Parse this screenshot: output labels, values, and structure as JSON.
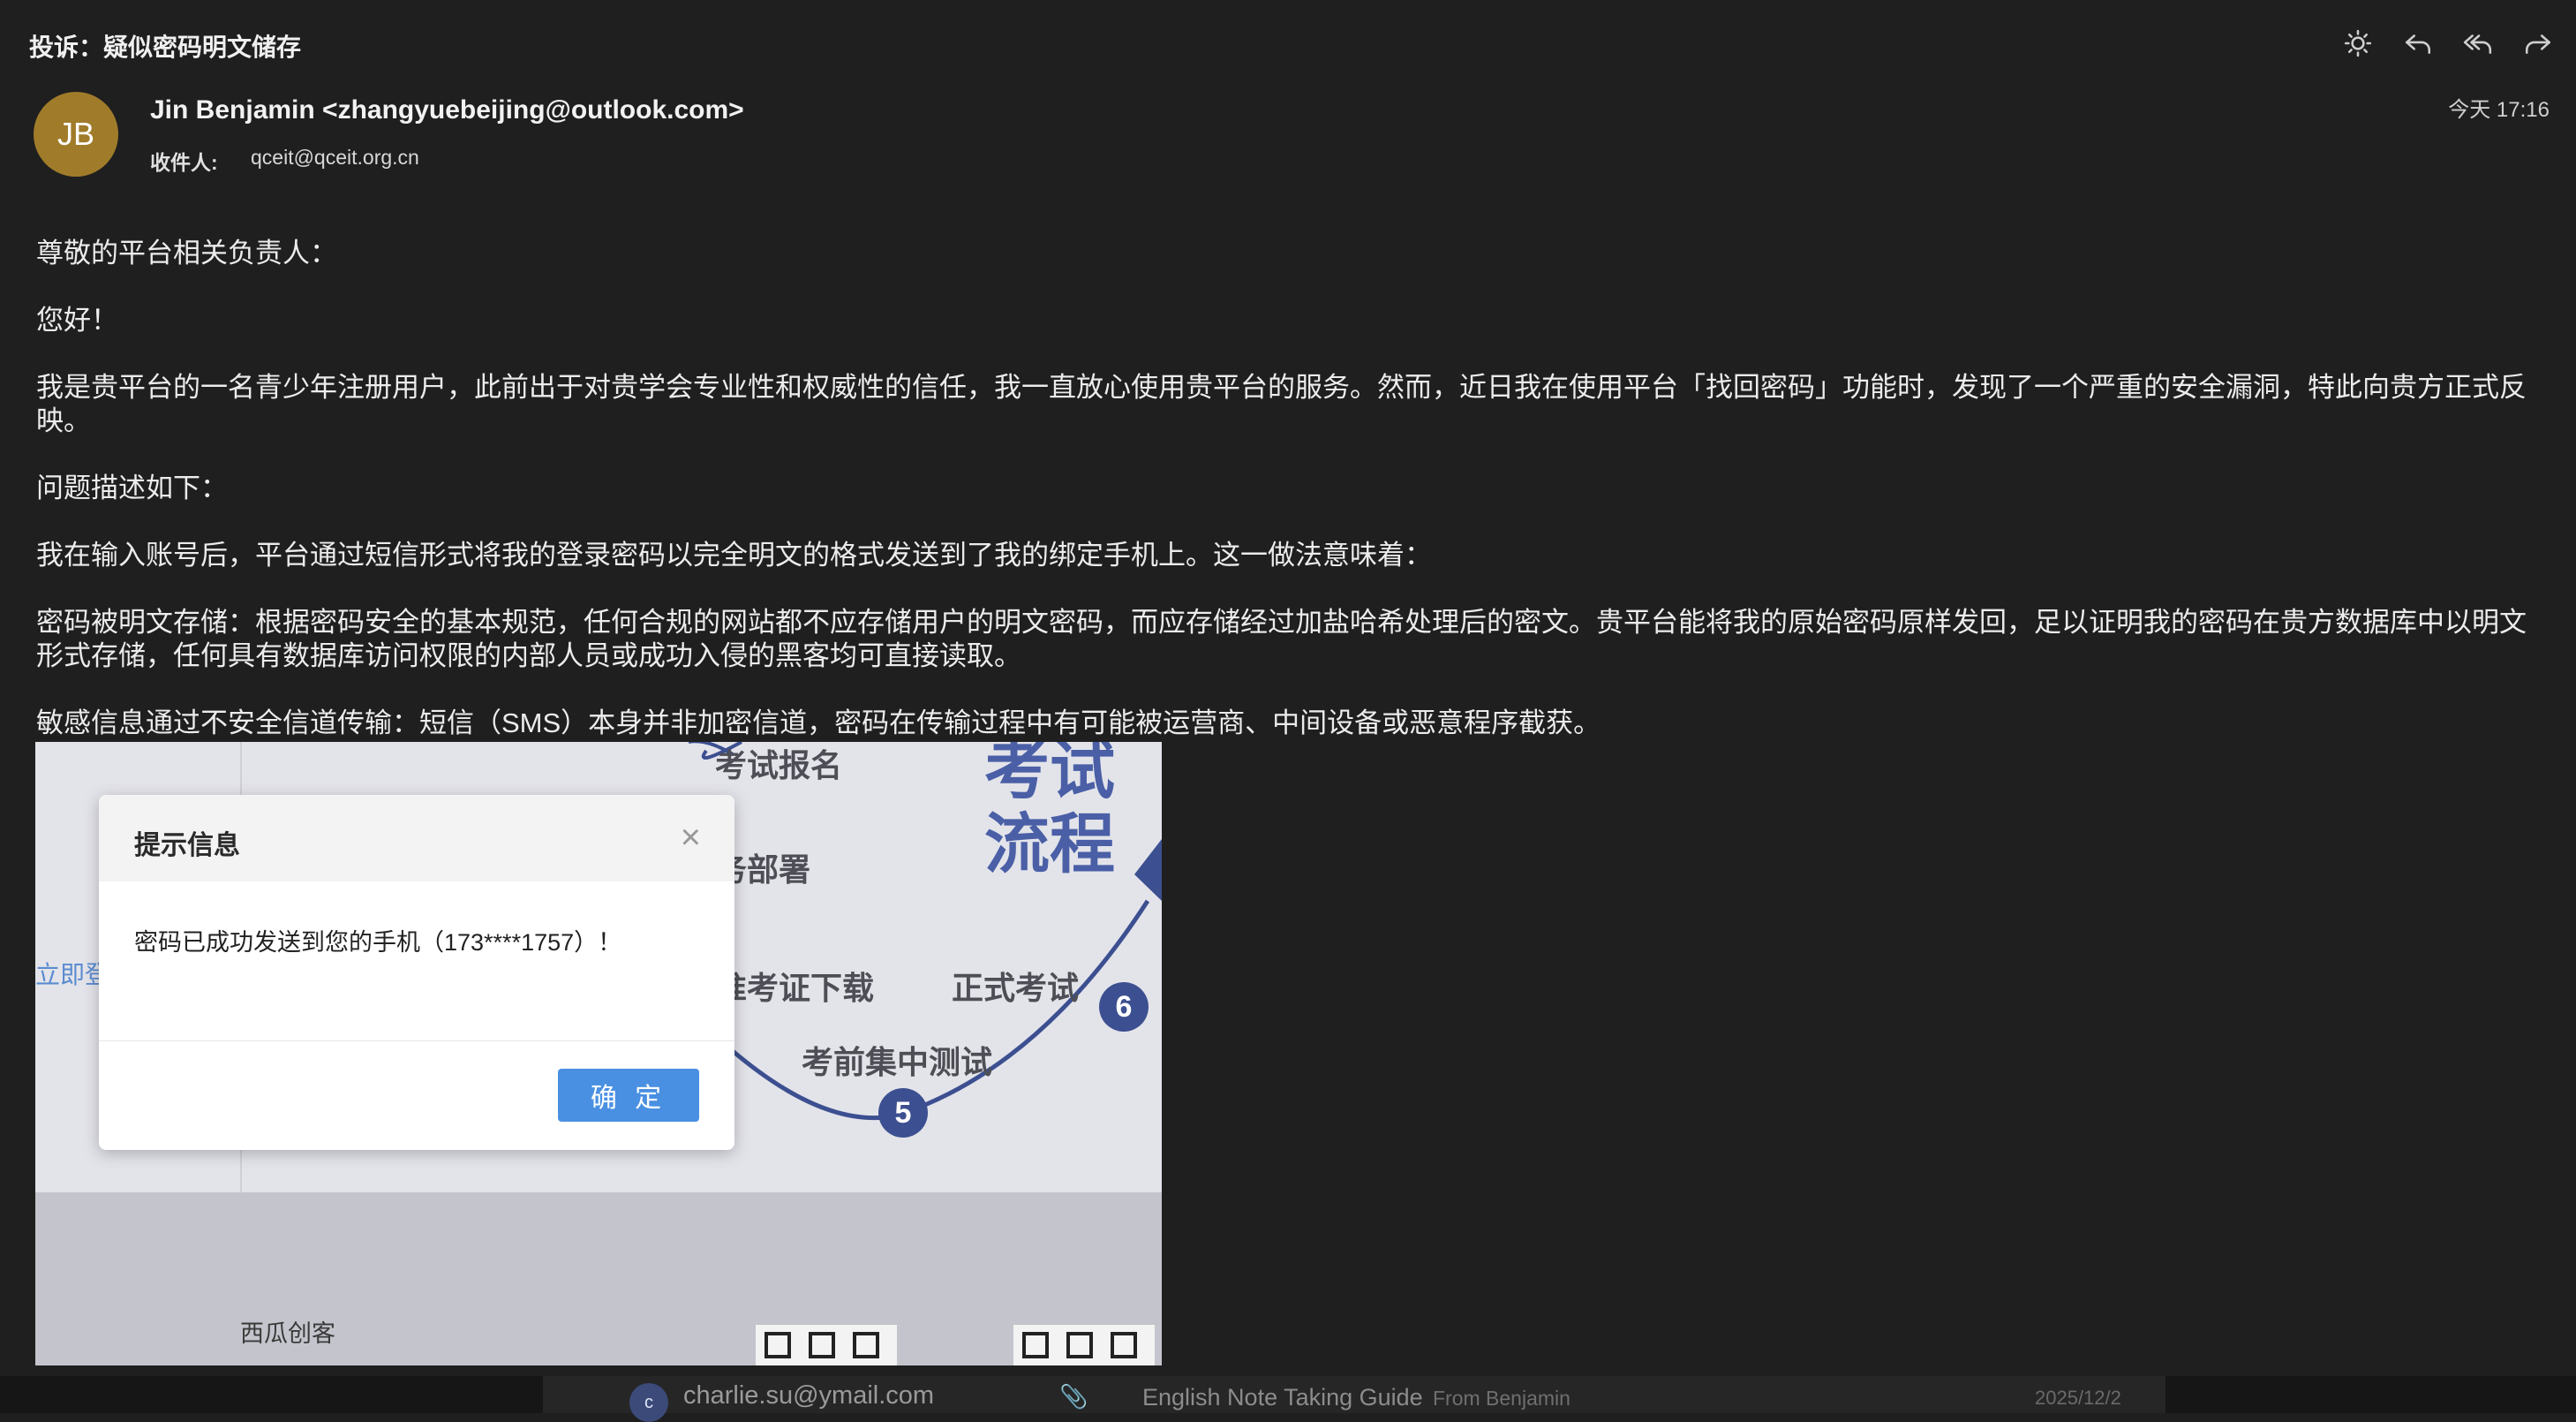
{
  "email": {
    "subject": "投诉：疑似密码明文储存",
    "avatar_initials": "JB",
    "sender": "Jin Benjamin <zhangyuebeijing@outlook.com>",
    "recipient_label": "收件人:",
    "recipient": "qceit@qceit.org.cn",
    "date": "今天 17:16",
    "colors": {
      "avatar": "#a07c2a",
      "background": "#1f1f1f"
    },
    "toolbar_icons": [
      "brightness-icon",
      "reply-icon",
      "reply-all-icon",
      "forward-icon"
    ],
    "body": {
      "greeting": "尊敬的平台相关负责人：",
      "hello": "您好！",
      "p1": "我是贵平台的一名青少年注册用户，此前出于对贵学会专业性和权威性的信任，我一直放心使用贵平台的服务。然而，近日我在使用平台「找回密码」功能时，发现了一个严重的安全漏洞，特此向贵方正式反映。",
      "p2": "问题描述如下：",
      "p3": "我在输入账号后，平台通过短信形式将我的登录密码以完全明文的格式发送到了我的绑定手机上。这一做法意味着：",
      "p4": "密码被明文存储：根据密码安全的基本规范，任何合规的网站都不应存储用户的明文密码，而应存储经过加盐哈希处理后的密文。贵平台能将我的原始密码原样发回，足以证明我的密码在贵方数据库中以明文形式存储，任何具有数据库访问权限的内部人员或成功入侵的黑客均可直接读取。",
      "p5": "敏感信息通过不安全信道传输：短信（SMS）本身并非加密信道，密码在传输过程中有可能被运营商、中间设备或恶意程序截获。"
    }
  },
  "screenshot": {
    "flow_title": "考试\n流程",
    "labels": {
      "signup": "考试报名",
      "deploy": "务部署",
      "admit": "准考证下载",
      "exam": "正式考试",
      "pretest": "考前集中测试"
    },
    "steps": {
      "five": "5",
      "six": "6"
    },
    "login_link": "立即登",
    "footer_text": "西瓜创客",
    "dialog": {
      "title": "提示信息",
      "close": "×",
      "message": "密码已成功发送到您的手机（173****1757）！",
      "ok": "确 定",
      "ok_color": "#4a90e2"
    }
  },
  "background_list": {
    "avatar_initial": "c",
    "email": "charlie.su@ymail.com",
    "subject": "English Note Taking Guide",
    "from": "From Benjamin",
    "date": "2025/12/2"
  }
}
